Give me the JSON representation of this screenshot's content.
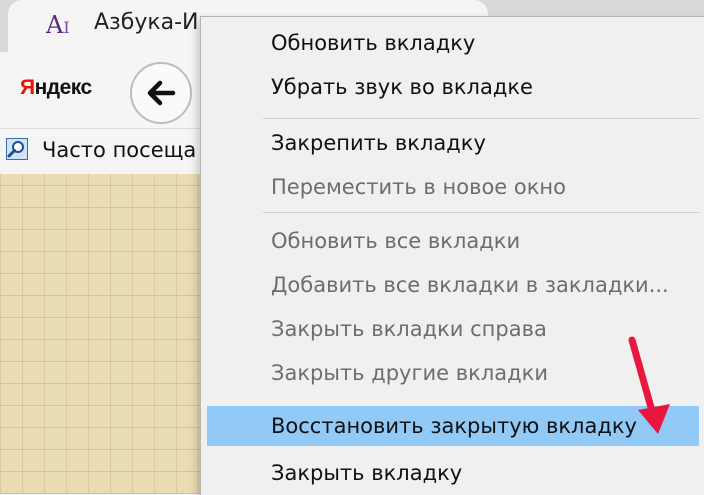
{
  "tab": {
    "title": "Азбука-Ин",
    "favicon_text": "A",
    "favicon_sub": "I"
  },
  "toolbar": {
    "yandex_logo_first": "Я",
    "yandex_logo_rest": "ндекс",
    "back_icon": "arrow-left-icon"
  },
  "bookmarks": {
    "label": "Часто посеща"
  },
  "context_menu": {
    "items": [
      {
        "label": "Обновить вкладку",
        "disabled": false
      },
      {
        "label": "Убрать звук во вкладке",
        "disabled": false
      },
      {
        "label": "Закрепить вкладку",
        "disabled": false
      },
      {
        "label": "Переместить в новое окно",
        "disabled": true
      },
      {
        "label": "Обновить все вкладки",
        "disabled": true
      },
      {
        "label": "Добавить все вкладки в закладки...",
        "disabled": true
      },
      {
        "label": "Закрыть вкладки справа",
        "disabled": true
      },
      {
        "label": "Закрыть другие вкладки",
        "disabled": true
      },
      {
        "label": "Восстановить закрытую вкладку",
        "disabled": false,
        "highlighted": true
      },
      {
        "label": "Закрыть вкладку",
        "disabled": false
      }
    ]
  },
  "colors": {
    "highlight": "#91c9f7",
    "arrow": "#e8173f",
    "page_background": "#eadcb3"
  }
}
